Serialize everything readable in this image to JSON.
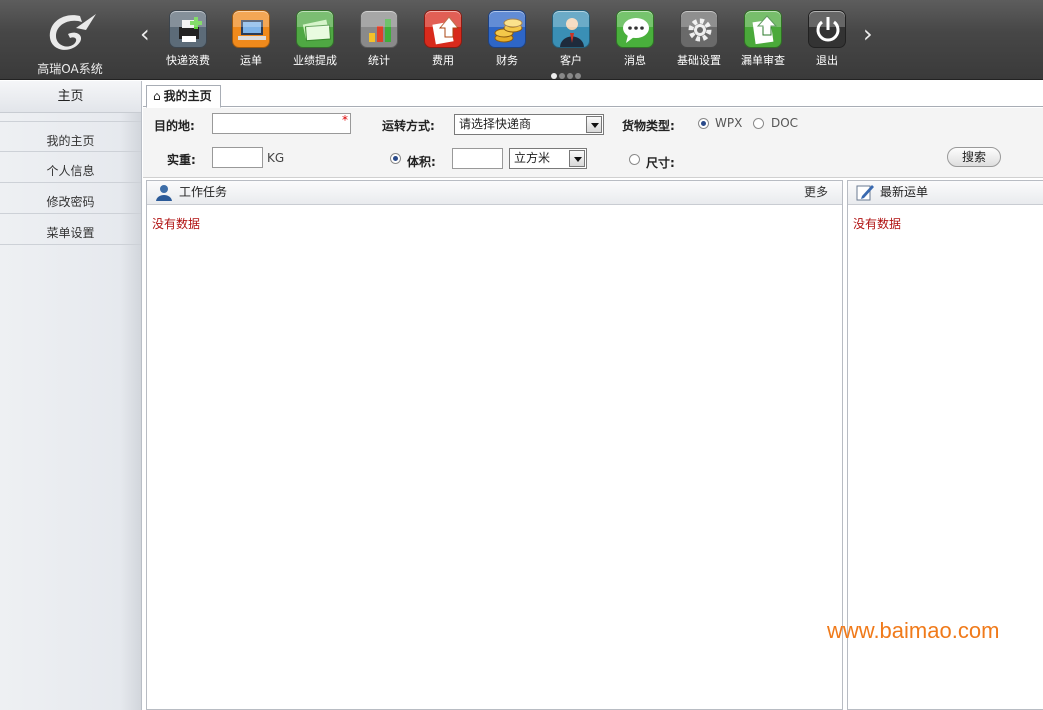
{
  "app": {
    "logo_text": "高瑞OA系统"
  },
  "toolbar": {
    "items": [
      {
        "label": "快递资费",
        "icon": "printer-icon",
        "color": "#5c6b78"
      },
      {
        "label": "运单",
        "icon": "laptop-icon",
        "color": "#f08a1c"
      },
      {
        "label": "业绩提成",
        "icon": "money-icon",
        "color": "#4fa843"
      },
      {
        "label": "统计",
        "icon": "bar-chart-icon",
        "color": "#8a8a8a"
      },
      {
        "label": "费用",
        "icon": "upload-arrow-icon",
        "color": "#d82a1c"
      },
      {
        "label": "财务",
        "icon": "coins-icon",
        "color": "#2e66c7"
      },
      {
        "label": "客户",
        "icon": "user-icon",
        "color": "#3a8fb5"
      },
      {
        "label": "消息",
        "icon": "chat-icon",
        "color": "#49b03c"
      },
      {
        "label": "基础设置",
        "icon": "gear-icon",
        "color": "#6a6a6a"
      },
      {
        "label": "漏单审查",
        "icon": "document-check-icon",
        "color": "#4aa93a"
      },
      {
        "label": "退出",
        "icon": "power-icon",
        "color": "#333333"
      }
    ],
    "prev_arrow": "‹",
    "next_arrow": "›"
  },
  "sidebar": {
    "header": "主页",
    "items": [
      "我的主页",
      "个人信息",
      "修改密码",
      "菜单设置"
    ]
  },
  "tab": {
    "label": "我的主页"
  },
  "form": {
    "destination_label": "目的地:",
    "destination_value": "",
    "required_mark": "*",
    "transport_label": "运转方式:",
    "transport_value": "请选择快递商",
    "cargo_label": "货物类型:",
    "cargo_options": [
      "WPX",
      "DOC"
    ],
    "cargo_selected": "WPX",
    "weight_label": "实重:",
    "weight_value": "",
    "weight_unit": "KG",
    "volume_label": "体积:",
    "volume_value": "",
    "volume_unit": "立方米",
    "size_label": "尺寸:",
    "search_button": "搜索"
  },
  "panels": {
    "tasks": {
      "title": "工作任务",
      "more": "更多",
      "empty": "没有数据"
    },
    "waybills": {
      "title": "最新运单",
      "empty": "没有数据"
    }
  },
  "watermark": "www.baimao.com"
}
